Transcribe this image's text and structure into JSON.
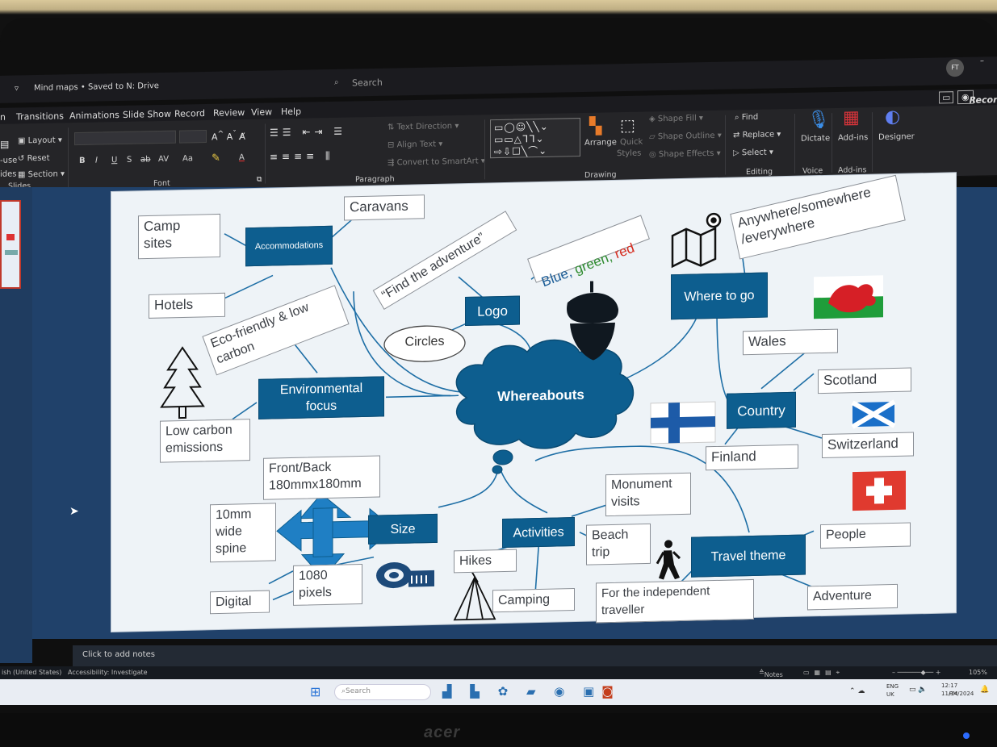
{
  "window": {
    "file_title": "Mind maps • Saved to N: Drive",
    "search_placeholder": "Search",
    "user_initials": "FT",
    "record_label": "Record"
  },
  "tabs": [
    "n",
    "Transitions",
    "Animations",
    "Slide Show",
    "Record",
    "Review",
    "View",
    "Help"
  ],
  "ribbon": {
    "slides": {
      "layout": "Layout",
      "reset": "Reset",
      "section": "Section",
      "reuse": "-use",
      "slides_frag": "ides",
      "group": "Slides"
    },
    "font": {
      "group": "Font",
      "bold": "B",
      "italic": "I",
      "underline": "U",
      "strike": "S",
      "ab": "ab",
      "av": "AV",
      "aa": "Aa",
      "a": "A"
    },
    "paragraph": {
      "group": "Paragraph",
      "text_direction": "Text Direction",
      "align_text": "Align Text",
      "convert": "Convert to SmartArt"
    },
    "drawing": {
      "group": "Drawing",
      "arrange": "Arrange",
      "quick": "Quick",
      "styles": "Styles",
      "shape_fill": "Shape Fill",
      "shape_outline": "Shape Outline",
      "shape_effects": "Shape Effects"
    },
    "editing": {
      "group": "Editing",
      "find": "Find",
      "replace": "Replace",
      "select": "Select"
    },
    "voice": {
      "group": "Voice",
      "dictate": "Dictate"
    },
    "addins": {
      "group": "Add-ins",
      "addins": "Add-ins"
    },
    "designer": {
      "label": "Designer"
    }
  },
  "notes": {
    "placeholder": "Click to add notes"
  },
  "status": {
    "language": "ish (United States)",
    "accessibility": "Accessibility: Investigate",
    "notes": "Notes",
    "zoom": "105%"
  },
  "taskbar": {
    "search": "Search",
    "lang1": "ENG",
    "lang2": "UK",
    "time": "12:17 PM",
    "date": "11/14/2024"
  },
  "monitor_brand": "acer",
  "mindmap": {
    "center": "Whereabouts",
    "accommodations": "Accommodations",
    "camp_sites": "Camp\nsites",
    "caravans": "Caravans",
    "hotels": "Hotels",
    "find_adventure": "“Find the adventure”",
    "logo": "Logo",
    "circles": "Circles",
    "blue_green_red": {
      "blue": "Blue, ",
      "green": "green, ",
      "red": "red"
    },
    "eco": "Eco-friendly & low\ncarbon",
    "env_focus": "Environmental\nfocus",
    "low_carbon": "Low carbon\nemissions",
    "where_to_go": "Where to go",
    "anywhere": "Anywhere/somewhere\n/everywhere",
    "wales": "Wales",
    "country": "Country",
    "scotland": "Scotland",
    "switzerland": "Switzerland",
    "finland": "Finland",
    "front_back": "Front/Back\n180mmx180mm",
    "spine": "10mm\nwide\nspine",
    "size": "Size",
    "pixels": "1080\npixels",
    "digital": "Digital",
    "activities": "Activities",
    "monument": "Monument\nvisits",
    "beach": "Beach\ntrip",
    "hikes": "Hikes",
    "camping": "Camping",
    "travel_theme": "Travel theme",
    "people": "People",
    "adventure": "Adventure",
    "independent": "For the independent\ntraveller"
  },
  "colors": {
    "accent": "#0d5e8f",
    "green": "#2e8b2e",
    "red": "#d62b1e",
    "slide_bg": "#eef3f7"
  }
}
